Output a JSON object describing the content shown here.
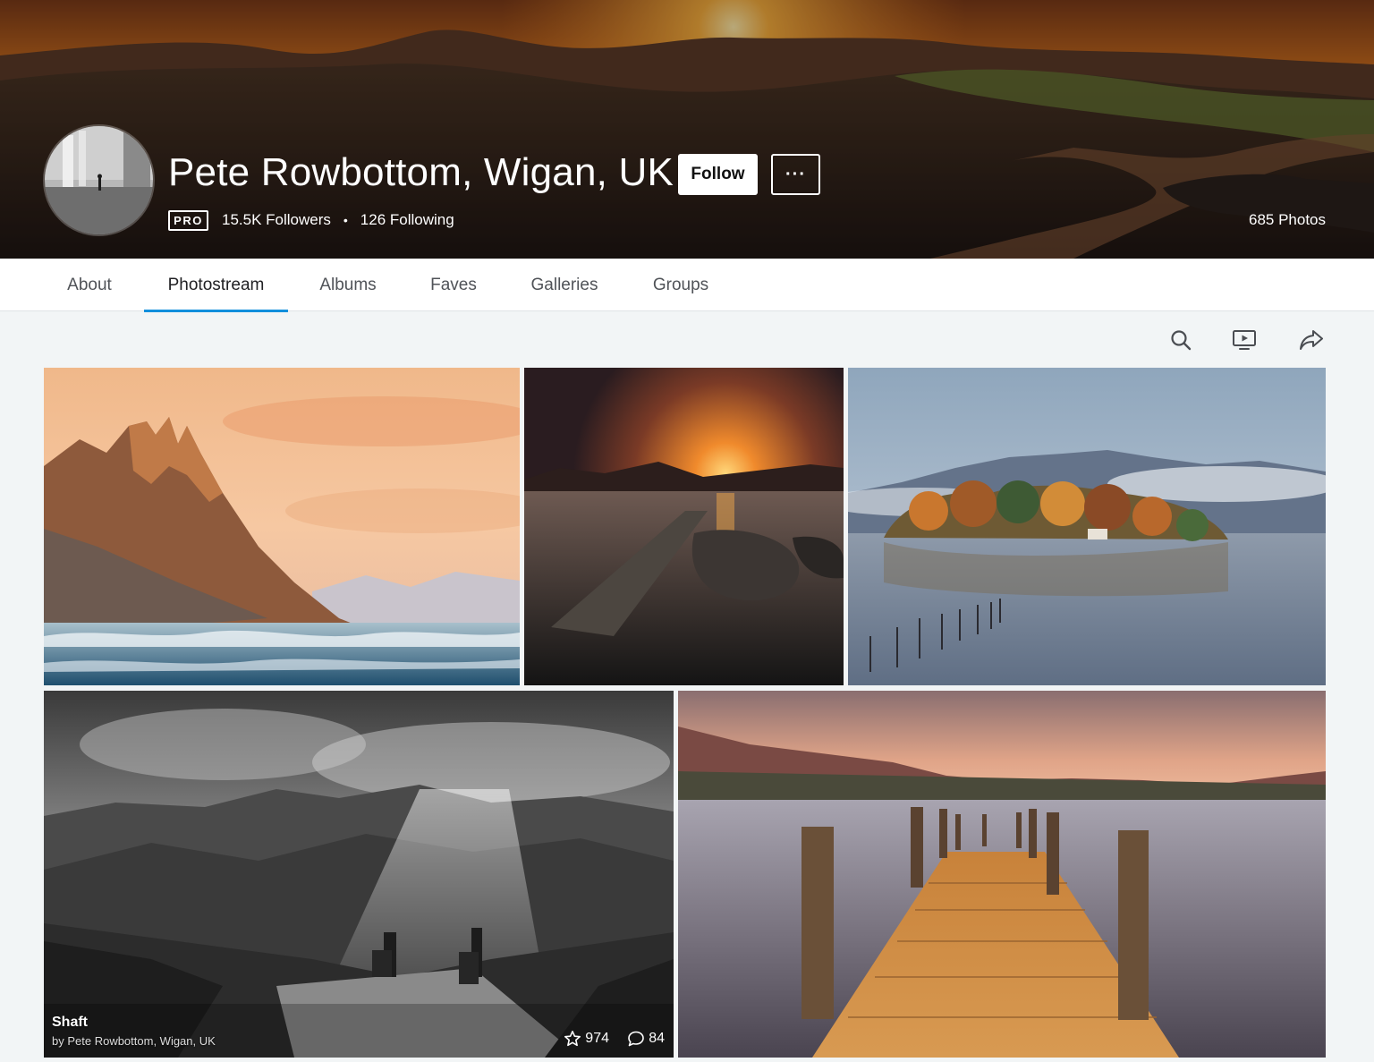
{
  "profile": {
    "name": "Pete Rowbottom, Wigan, UK",
    "pro_badge": "PRO",
    "followers": "15.5K Followers",
    "separator": "•",
    "following": "126 Following",
    "photo_count": "685 Photos",
    "follow_label": "Follow",
    "more_label": "···"
  },
  "subnav": {
    "tabs": [
      {
        "label": "About",
        "active": false
      },
      {
        "label": "Photostream",
        "active": true
      },
      {
        "label": "Albums",
        "active": false
      },
      {
        "label": "Faves",
        "active": false
      },
      {
        "label": "Galleries",
        "active": false
      },
      {
        "label": "Groups",
        "active": false
      }
    ],
    "accent_color": "#128fdc"
  },
  "toolbar": {
    "icons": [
      "search-icon",
      "slideshow-icon",
      "share-icon"
    ]
  },
  "photos": [
    {
      "scene": "mountain-peaks-sunset-waves"
    },
    {
      "scene": "lake-jetty-sunset"
    },
    {
      "scene": "misty-island-autumn"
    },
    {
      "scene": "black-white-mountain-chimneys",
      "title": "Shaft",
      "author": "by Pete Rowbottom, Wigan, UK",
      "faves": "974",
      "comments": "84"
    },
    {
      "scene": "wooden-pier-lake-dusk"
    }
  ]
}
